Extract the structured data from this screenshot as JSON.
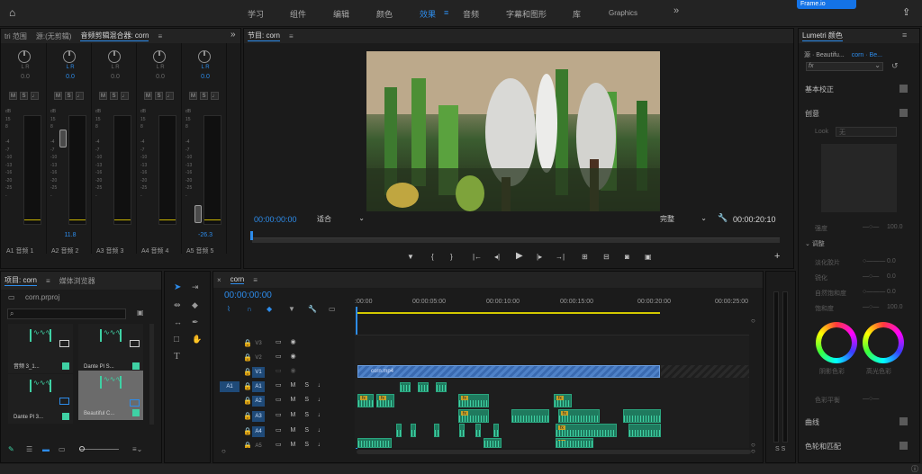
{
  "topbar": {
    "tabs": [
      "学习",
      "组件",
      "编辑",
      "颜色",
      "效果",
      "音频",
      "字幕和图形",
      "库",
      "Graphics"
    ],
    "active_tab": "效果",
    "more": "»",
    "badge": "Frame.io"
  },
  "mixer": {
    "tabs": [
      "tri 范围",
      "源:(无剪辑)",
      "音频剪辑混合器: corn"
    ],
    "expand": "»",
    "channels": [
      {
        "pan": "0.0",
        "fader": "",
        "name": "A1",
        "label": "音频 1"
      },
      {
        "pan": "0.0",
        "fader": "11.8",
        "name": "A2",
        "label": "音频 2"
      },
      {
        "pan": "0.0",
        "fader": "",
        "name": "A3",
        "label": "音频 3"
      },
      {
        "pan": "0.0",
        "fader": "",
        "name": "A4",
        "label": "音频 4"
      },
      {
        "pan": "0.0",
        "fader": "-26.3",
        "name": "A5",
        "label": "音频 5"
      }
    ],
    "lr": "L        R",
    "db_scale": [
      "dB",
      "15",
      "8",
      "",
      "-4",
      "-7",
      "-10",
      "-13",
      "-16",
      "-20",
      "-25",
      "-"
    ]
  },
  "program": {
    "title": "节目: corn",
    "timecode_current": "00:00:00:00",
    "fit": "适合",
    "quality": "完整",
    "timecode_duration": "00:00:20:10"
  },
  "project": {
    "tabs": [
      "项目: corn",
      "媒体浏览器"
    ],
    "file": "corn.prproj",
    "items": [
      {
        "name": "音频 3_1...",
        "selected": false
      },
      {
        "name": "Dante Pl S...",
        "selected": false
      },
      {
        "name": "Dante Pl 3...",
        "selected": false
      },
      {
        "name": "Beautiful C...",
        "selected": true
      }
    ]
  },
  "timeline": {
    "title": "corn",
    "timecode": "00:00:00:00",
    "ruler": [
      ":00:00",
      "00:00:05:00",
      "00:00:10:00",
      "00:00:15:00",
      "00:00:20:00",
      "00:00:25:00"
    ],
    "tracks": [
      {
        "name": "V3",
        "icons": "▭ ◉",
        "on": false
      },
      {
        "name": "V2",
        "icons": "▭ ◉",
        "on": false
      },
      {
        "name": "V1",
        "icons": "▭ ◉",
        "on": true
      },
      {
        "name": "A1",
        "icons": "▭ M S ♩",
        "on": true
      },
      {
        "name": "A2",
        "icons": "▭ M S ♩",
        "on": true
      },
      {
        "name": "A3",
        "icons": "▭ M S ♩",
        "on": true
      },
      {
        "name": "A4",
        "icons": "▭ M S ♩",
        "on": true
      },
      {
        "name": "A5",
        "icons": "▭ M S ♩",
        "on": false
      }
    ],
    "video_clip": "corn.mp4",
    "source_patch": "A1",
    "meter_labels": "S S"
  },
  "lumetri": {
    "title": "Lumetri 颜色",
    "source": "源 · Beautifu...",
    "target": "corn · Be...",
    "sections": [
      "基本校正",
      "创意",
      "曲线",
      "色轮和匹配"
    ],
    "look_label": "Look",
    "look_value": "无",
    "intensity_label": "强度",
    "intensity_value": "100.0",
    "adjust": "调整",
    "params": [
      {
        "label": "淡化胶片",
        "value": "0.0"
      },
      {
        "label": "锐化",
        "value": "0.0"
      },
      {
        "label": "自然饱和度",
        "value": "0.0"
      },
      {
        "label": "饱和度",
        "value": "100.0"
      }
    ],
    "wheels": [
      "阴影色彩",
      "高光色彩"
    ],
    "tint_balance": "色彩平衡"
  }
}
